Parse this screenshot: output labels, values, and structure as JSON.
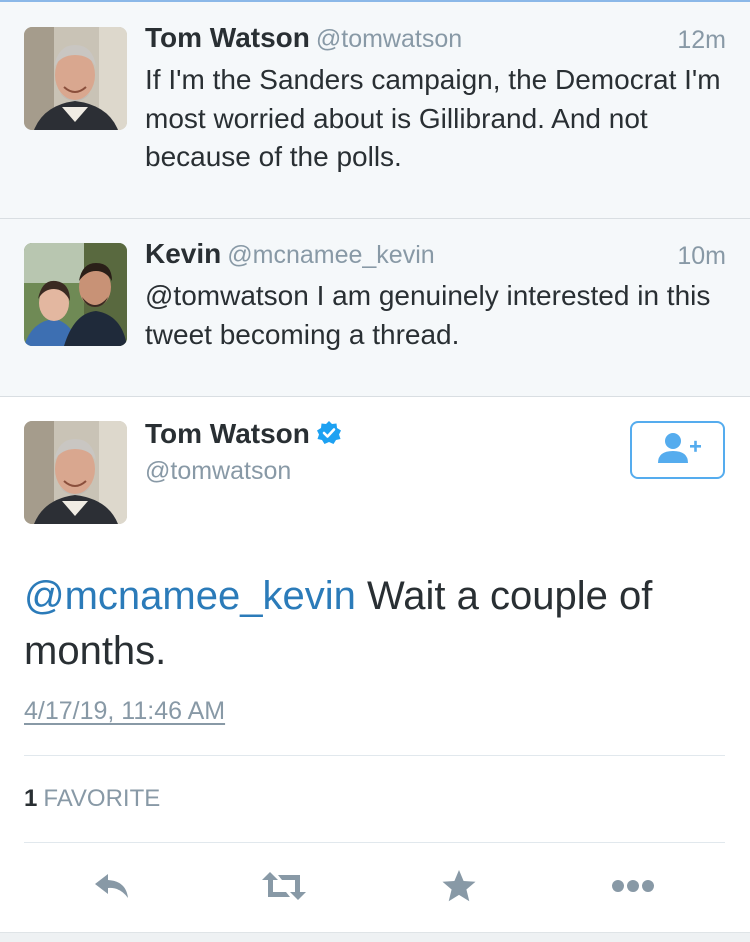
{
  "colors": {
    "accent": "#55acee",
    "mention": "#2b7bb9",
    "muted_text": "#8899a6",
    "body_text": "#292f33",
    "reply_bg": "#f5f8fa"
  },
  "replies": [
    {
      "name": "Tom Watson",
      "handle": "@tomwatson",
      "time": "12m",
      "text": "If I'm the Sanders campaign, the Democrat I'm most worried about is Gillibrand. And not because of the polls."
    },
    {
      "name": "Kevin",
      "handle": "@mcnamee_kevin",
      "time": "10m",
      "text": "@tomwatson I am genuinely interested in this tweet becoming a thread."
    }
  ],
  "main_tweet": {
    "name": "Tom Watson",
    "handle": "@tomwatson",
    "verified_icon": "verified-badge-icon",
    "follow_icon": "add-user-icon",
    "mention": "@mcnamee_kevin",
    "text": " Wait a couple of months.",
    "timestamp": "4/17/19, 11:46 AM",
    "favorite_count": "1",
    "favorite_label": "FAVORITE"
  },
  "actions": {
    "reply_icon": "reply-icon",
    "retweet_icon": "retweet-icon",
    "favorite_icon": "star-icon",
    "more_icon": "more-icon"
  }
}
